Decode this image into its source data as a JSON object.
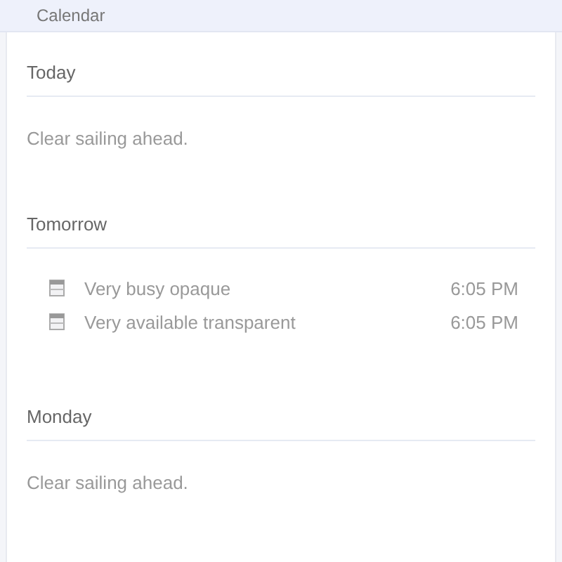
{
  "header": {
    "title": "Calendar"
  },
  "days": [
    {
      "label": "Today",
      "empty_text": "Clear sailing ahead."
    },
    {
      "label": "Tomorrow",
      "events": [
        {
          "title": "Very busy opaque",
          "time": "6:05 PM"
        },
        {
          "title": "Very available transparent",
          "time": "6:05 PM"
        }
      ]
    },
    {
      "label": "Monday",
      "empty_text": "Clear sailing ahead."
    }
  ]
}
